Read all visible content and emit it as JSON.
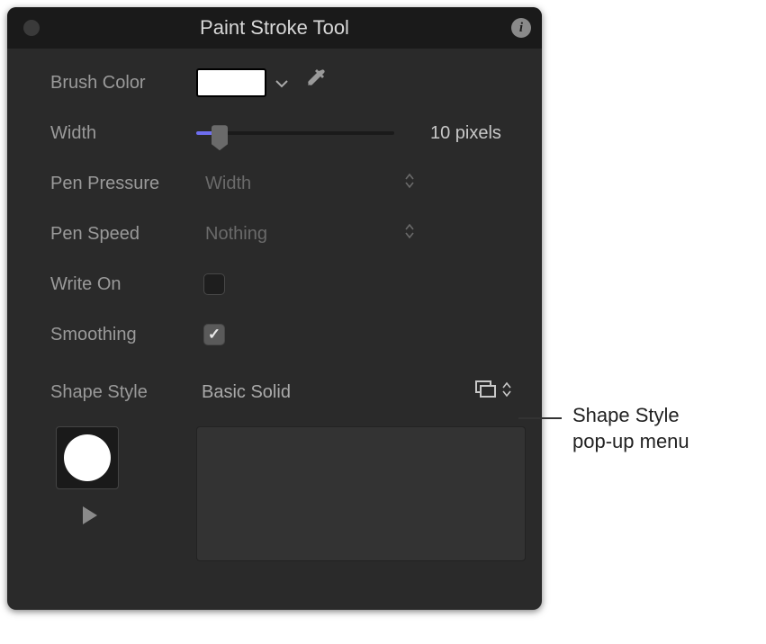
{
  "titlebar": {
    "title": "Paint Stroke Tool"
  },
  "rows": {
    "brushColorLabel": "Brush Color",
    "widthLabel": "Width",
    "widthValue": "10 pixels",
    "penPressureLabel": "Pen Pressure",
    "penPressureValue": "Width",
    "penSpeedLabel": "Pen Speed",
    "penSpeedValue": "Nothing",
    "writeOnLabel": "Write On",
    "writeOnChecked": false,
    "smoothingLabel": "Smoothing",
    "smoothingChecked": true,
    "shapeStyleLabel": "Shape Style",
    "shapeStyleValue": "Basic Solid"
  },
  "colors": {
    "brushSwatch": "#ffffff",
    "sliderFill": "#6e6ef0"
  },
  "slider": {
    "percent": 12
  },
  "callout": {
    "line1": "Shape Style",
    "line2": "pop-up menu"
  }
}
